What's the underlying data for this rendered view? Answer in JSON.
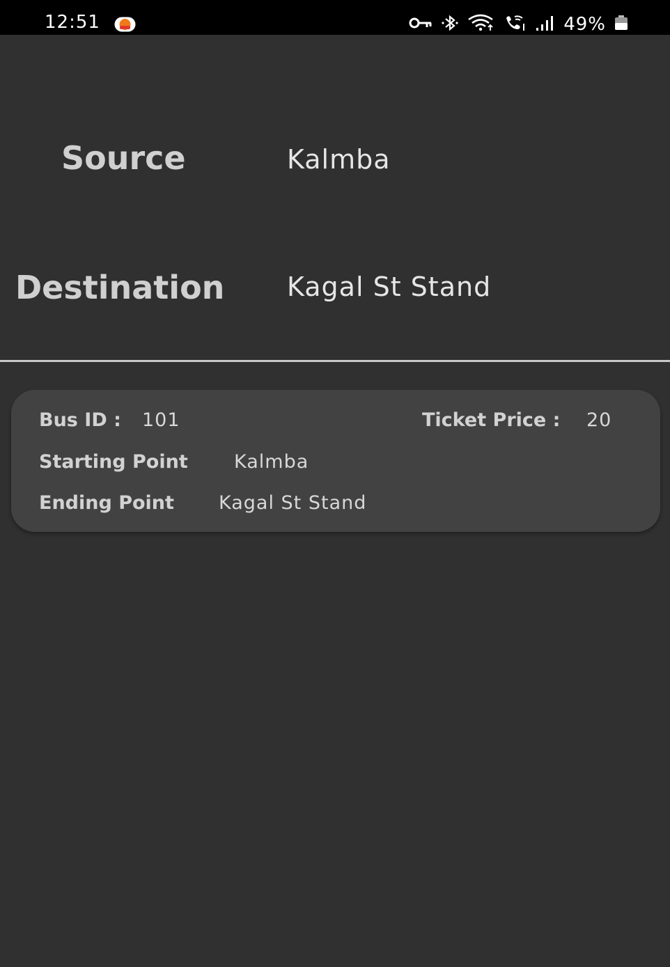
{
  "status_bar": {
    "time": "12:51",
    "battery_percent": "49%",
    "icons": [
      "app-notification-icon",
      "vpn-key-icon",
      "bluetooth-icon",
      "wifi-icon",
      "wifi-calling-icon",
      "cell-signal-icon",
      "battery-icon"
    ]
  },
  "route": {
    "source_label": "Source",
    "source_value": "Kalmba",
    "destination_label": "Destination",
    "destination_value": "Kagal St Stand"
  },
  "bus_card": {
    "bus_id_label": "Bus ID :",
    "bus_id_value": "101",
    "ticket_price_label": "Ticket Price :",
    "ticket_price_value": "20",
    "starting_point_label": "Starting Point",
    "starting_point_value": "Kalmba",
    "ending_point_label": "Ending Point",
    "ending_point_value": "Kagal St Stand"
  },
  "colors": {
    "background": "#303030",
    "card": "#424242",
    "status_bar": "#000000",
    "text": "#d0d0d0"
  }
}
